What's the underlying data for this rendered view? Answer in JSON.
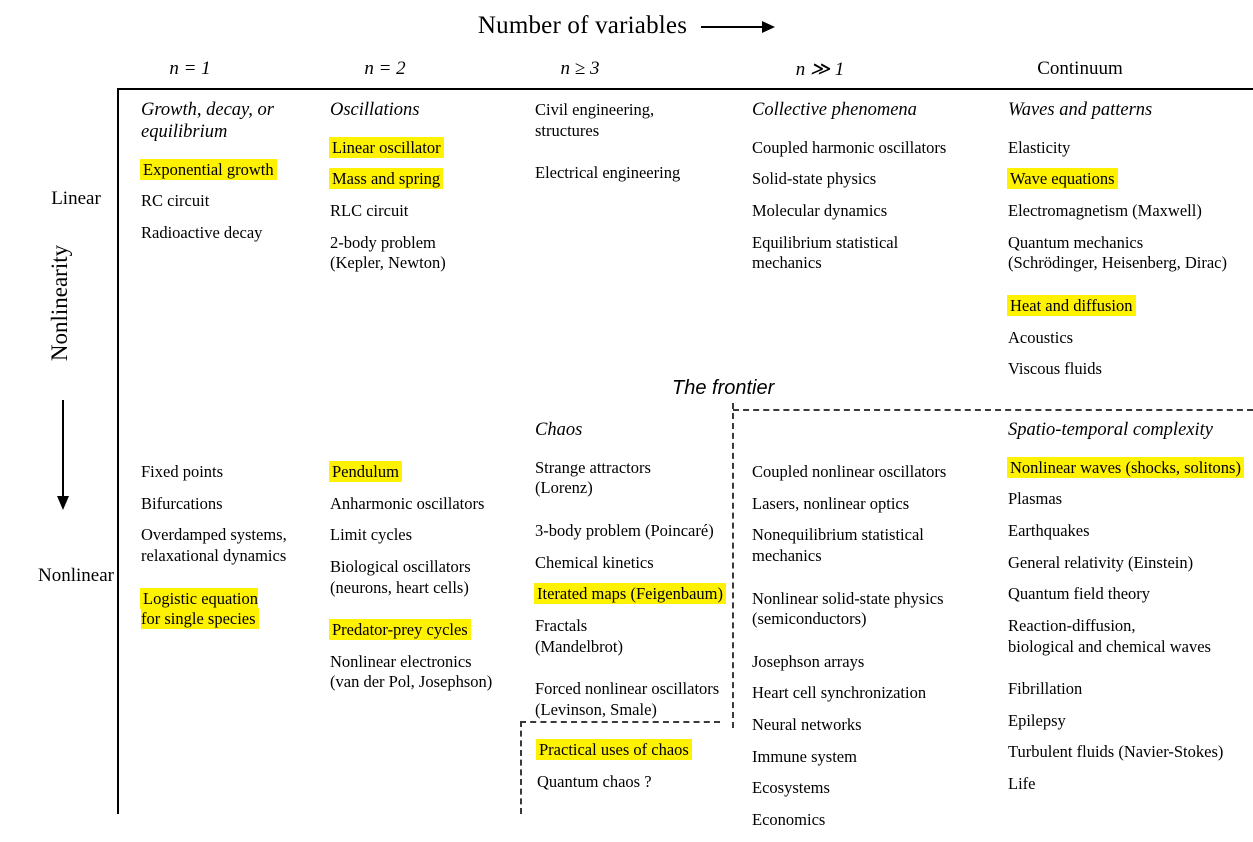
{
  "header": {
    "title": "Number of variables",
    "arrow_icon": "right-arrow-icon",
    "columns": [
      {
        "label": "n = 1",
        "math": true
      },
      {
        "label": "n = 2",
        "math": true
      },
      {
        "label": "n ≥ 3",
        "math": true
      },
      {
        "label": "n ≫ 1",
        "math": true
      },
      {
        "label": "Continuum",
        "math": false
      }
    ]
  },
  "axis": {
    "vertical_label": "Nonlinearity",
    "top_label": "Linear",
    "bottom_label": "Nonlinear",
    "arrow_icon": "down-arrow-icon"
  },
  "frontier": {
    "label": "The frontier"
  },
  "colors": {
    "highlight": "#fff200",
    "rule": "#000000",
    "dashed": "#3a3a3a"
  },
  "linear_row": [
    {
      "category": "Growth, decay, or\nequilibrium",
      "items": [
        {
          "text": "Exponential growth",
          "highlight": true
        },
        {
          "text": "RC circuit",
          "highlight": false
        },
        {
          "text": "Radioactive decay",
          "highlight": false
        }
      ]
    },
    {
      "category": "Oscillations",
      "items": [
        {
          "text": "Linear oscillator",
          "highlight": true
        },
        {
          "text": "Mass and spring",
          "highlight": true
        },
        {
          "text": "RLC circuit",
          "highlight": false
        },
        {
          "text": "2-body problem\n(Kepler, Newton)",
          "highlight": false
        }
      ]
    },
    {
      "category": "",
      "items": [
        {
          "text": "Civil engineering,\nstructures",
          "highlight": false,
          "gap": true
        },
        {
          "text": "Electrical engineering",
          "highlight": false
        }
      ]
    },
    {
      "category": "Collective phenomena",
      "items": [
        {
          "text": "Coupled harmonic oscillators",
          "highlight": false
        },
        {
          "text": "Solid-state physics",
          "highlight": false
        },
        {
          "text": "Molecular dynamics",
          "highlight": false
        },
        {
          "text": "Equilibrium statistical\nmechanics",
          "highlight": false
        }
      ]
    },
    {
      "category": "Waves and patterns",
      "items": [
        {
          "text": "Elasticity",
          "highlight": false
        },
        {
          "text": "Wave equations",
          "highlight": true
        },
        {
          "text": "Electromagnetism (Maxwell)",
          "highlight": false
        },
        {
          "text": "Quantum mechanics\n(Schrödinger, Heisenberg, Dirac)",
          "highlight": false,
          "gap": true
        },
        {
          "text": "Heat and diffusion",
          "highlight": true
        },
        {
          "text": "Acoustics",
          "highlight": false
        },
        {
          "text": "Viscous fluids",
          "highlight": false
        }
      ]
    }
  ],
  "nonlinear_row": [
    {
      "category": "",
      "items": [
        {
          "text": "Fixed points",
          "highlight": false
        },
        {
          "text": "Bifurcations",
          "highlight": false
        },
        {
          "text": "Overdamped systems,\nrelaxational dynamics",
          "highlight": false,
          "gap": true
        },
        {
          "text": "Logistic equation\nfor single species",
          "highlight": true
        }
      ]
    },
    {
      "category": "",
      "items": [
        {
          "text": "Pendulum",
          "highlight": true
        },
        {
          "text": "Anharmonic oscillators",
          "highlight": false
        },
        {
          "text": "Limit cycles",
          "highlight": false
        },
        {
          "text": "Biological oscillators\n(neurons, heart cells)",
          "highlight": false,
          "gap": true
        },
        {
          "text": "Predator-prey cycles",
          "highlight": true
        },
        {
          "text": "Nonlinear electronics\n(van der Pol, Josephson)",
          "highlight": false
        }
      ]
    },
    {
      "category": "Chaos",
      "items": [
        {
          "text": "Strange attractors\n(Lorenz)",
          "highlight": false,
          "gap": true
        },
        {
          "text": "3-body problem (Poincaré)",
          "highlight": false
        },
        {
          "text": "Chemical kinetics",
          "highlight": false
        },
        {
          "text": "Iterated maps (Feigenbaum)",
          "highlight": true
        },
        {
          "text": "Fractals\n(Mandelbrot)",
          "highlight": false,
          "gap": true
        },
        {
          "text": "Forced nonlinear oscillators\n(Levinson, Smale)",
          "highlight": false
        }
      ]
    },
    {
      "category": "",
      "items": [
        {
          "text": "Coupled nonlinear oscillators",
          "highlight": false
        },
        {
          "text": "Lasers, nonlinear optics",
          "highlight": false
        },
        {
          "text": "Nonequilibrium statistical\nmechanics",
          "highlight": false,
          "gap": true
        },
        {
          "text": "Nonlinear solid-state physics\n(semiconductors)",
          "highlight": false,
          "gap": true
        },
        {
          "text": "Josephson arrays",
          "highlight": false
        },
        {
          "text": "Heart cell synchronization",
          "highlight": false
        },
        {
          "text": "Neural networks",
          "highlight": false
        },
        {
          "text": "Immune system",
          "highlight": false
        },
        {
          "text": "Ecosystems",
          "highlight": false
        },
        {
          "text": "Economics",
          "highlight": false
        }
      ]
    },
    {
      "category": "Spatio-temporal complexity",
      "items": [
        {
          "text": "Nonlinear waves (shocks, solitons)",
          "highlight": true
        },
        {
          "text": "Plasmas",
          "highlight": false
        },
        {
          "text": "Earthquakes",
          "highlight": false
        },
        {
          "text": "General relativity (Einstein)",
          "highlight": false
        },
        {
          "text": "Quantum field theory",
          "highlight": false
        },
        {
          "text": "Reaction-diffusion,\nbiological and chemical waves",
          "highlight": false,
          "gap": true
        },
        {
          "text": "Fibrillation",
          "highlight": false
        },
        {
          "text": "Epilepsy",
          "highlight": false
        },
        {
          "text": "Turbulent fluids (Navier-Stokes)",
          "highlight": false
        },
        {
          "text": "Life",
          "highlight": false
        }
      ]
    }
  ],
  "frontier_box": {
    "items": [
      {
        "text": "Practical uses of chaos",
        "highlight": true
      },
      {
        "text": "Quantum chaos ?",
        "highlight": false
      }
    ]
  }
}
